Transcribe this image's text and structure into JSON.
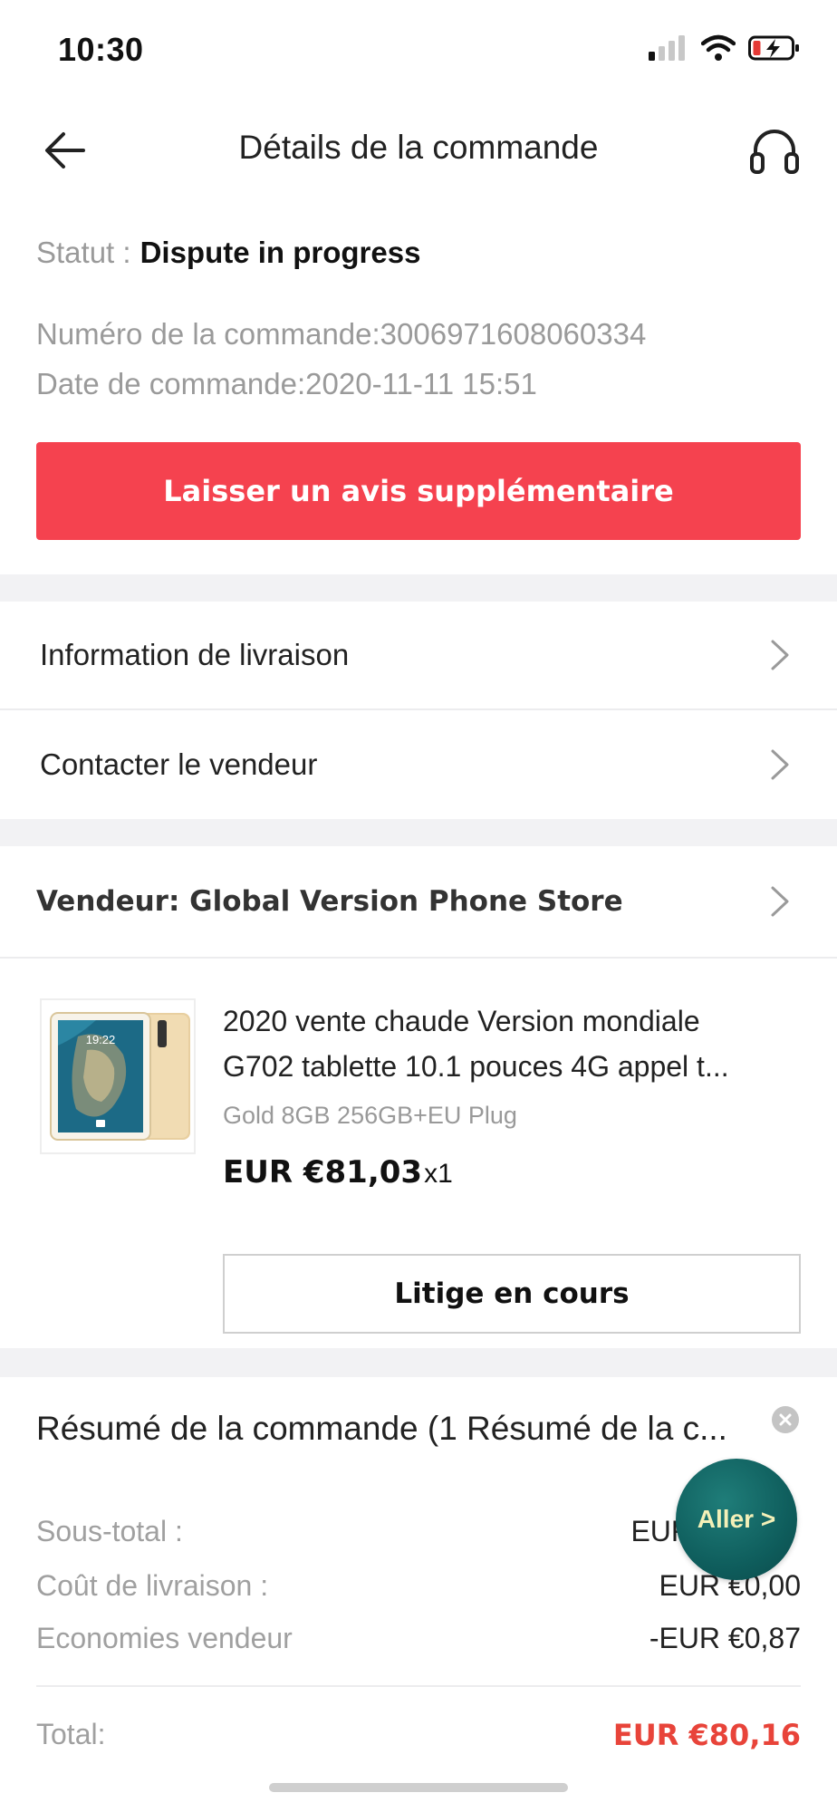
{
  "status_bar": {
    "time": "10:30"
  },
  "header": {
    "title": "Détails de la commande",
    "back_icon": "arrow-left-icon",
    "support_icon": "headset-icon"
  },
  "order": {
    "status_label": "Statut :",
    "status_value": "Dispute in progress",
    "number_line": "Numéro de la commande:3006971608060334",
    "date_line": "Date de commande:2020-11-11 15:51",
    "review_button": "Laisser un avis supplémentaire"
  },
  "links": {
    "delivery_info": "Information de livraison",
    "contact_seller": "Contacter le vendeur"
  },
  "seller": {
    "label": "Vendeur: Global Version Phone Store"
  },
  "product": {
    "title_line1": "2020 vente chaude Version mondiale",
    "title_line2": "G702 tablette 10.1 pouces 4G appel t...",
    "variant": "Gold 8GB 256GB+EU Plug",
    "price": "EUR €81,03",
    "quantity": "x1",
    "dispute_button": "Litige en cours",
    "thumb_time": "19:22"
  },
  "summary": {
    "title": "Résumé de la commande (1 Résumé de la c...",
    "subtotal_label": "Sous-total :",
    "subtotal_value": "EUR",
    "shipping_label": "Coût de livraison :",
    "shipping_value": "EUR €0,00",
    "savings_label": "Economies vendeur",
    "savings_value": "-EUR €0,87",
    "total_label": "Total:",
    "total_value": "EUR €80,16"
  },
  "floating": {
    "aller_label": "Aller >"
  },
  "colors": {
    "accent": "#f5424f",
    "total": "#e8443a",
    "floating": "#0f5e5d"
  }
}
